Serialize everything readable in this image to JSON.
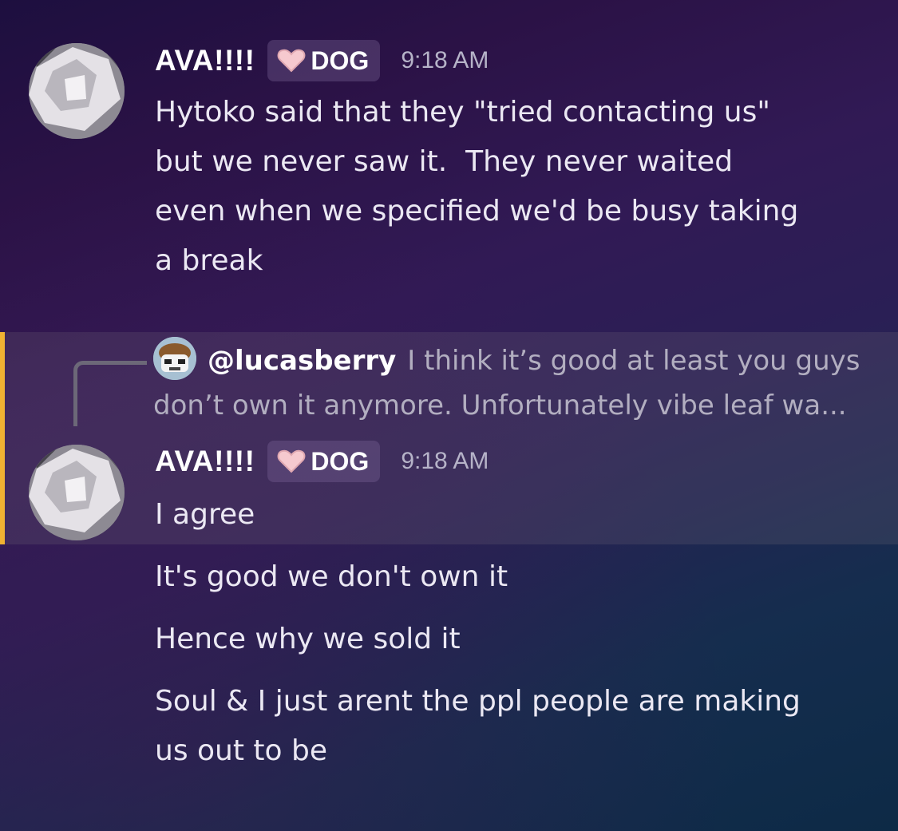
{
  "messages": [
    {
      "username": "AVA!!!!",
      "tag": "DOG",
      "time": "9:18 AM",
      "text": "Hytoko said that they \"tried contacting us\"\nbut we never saw it.  They never waited\neven when we specified we'd be busy taking\na break"
    },
    {
      "username": "AVA!!!!",
      "tag": "DOG",
      "time": "9:18 AM",
      "reply": {
        "mention": "@lucasberry",
        "preview": "I think it’s good at least you guys don’t own it anymore. Unfortunately vibe leaf wa..."
      },
      "text": "I agree"
    }
  ],
  "followups": [
    {
      "text": "It's good we don't own it"
    },
    {
      "text": "Hence why we sold it"
    },
    {
      "text": "Soul & I just arent the ppl people are making\nus out to be"
    }
  ],
  "colors": {
    "reply_highlight_bar": "#f0b232",
    "tag_heart": "#f6c9cf"
  }
}
